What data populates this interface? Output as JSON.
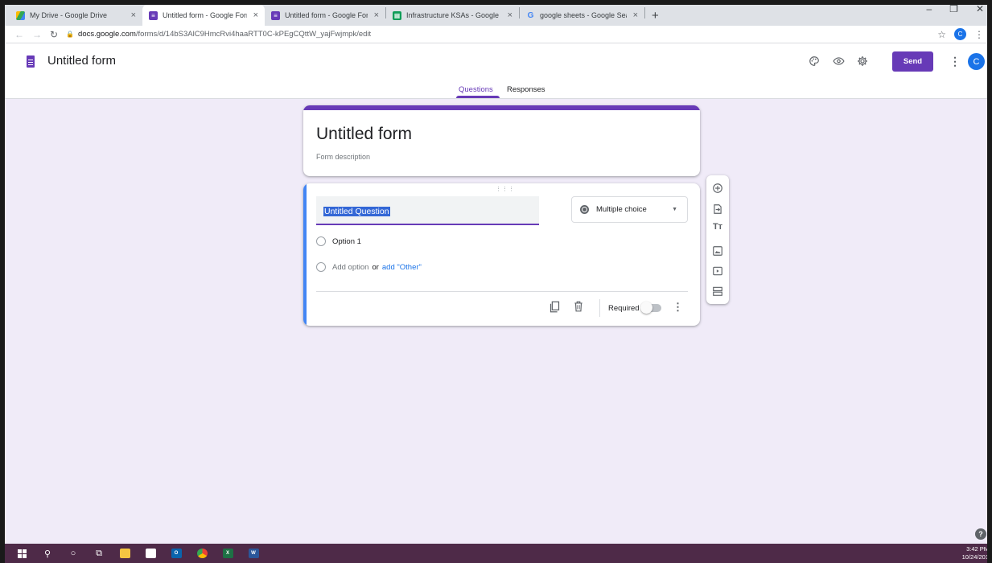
{
  "browser": {
    "tabs": [
      {
        "title": "My Drive - Google Drive",
        "icon": "google-drive-icon",
        "active": false
      },
      {
        "title": "Untitled form - Google Forms",
        "icon": "google-forms-icon",
        "active": true
      },
      {
        "title": "Untitled form - Google Forms",
        "icon": "google-forms-icon",
        "active": false
      },
      {
        "title": "Infrastructure KSAs - Google She",
        "icon": "google-sheets-icon",
        "active": false
      },
      {
        "title": "google sheets - Google Search",
        "icon": "google-g-icon",
        "active": false
      }
    ],
    "close_glyph": "×",
    "new_tab_glyph": "+",
    "url_host": "docs.google.com",
    "url_path": "/forms/d/14bS3AlC9HmcRvi4haaRTT0C-kPEgCQttW_yajFwjmpk/edit",
    "profile_initial": "C"
  },
  "header": {
    "app_title": "Untitled form",
    "send_label": "Send",
    "avatar_initial": "C",
    "tabs": {
      "questions": "Questions",
      "responses": "Responses"
    }
  },
  "form": {
    "title": "Untitled form",
    "description_placeholder": "Form description",
    "question": {
      "title": "Untitled Question",
      "type": "Multiple choice",
      "options": [
        "Option 1"
      ],
      "add_option": "Add option",
      "or": "or",
      "add_other": "add \"Other\"",
      "required_label": "Required",
      "required": false
    }
  },
  "taskbar": {
    "time": "3:42 PM",
    "date": "10/24/201"
  },
  "colors": {
    "accent": "#673ab7",
    "background": "#f0ebf8",
    "active_question_bar": "#4285f4",
    "taskbar": "#4e2a48"
  }
}
